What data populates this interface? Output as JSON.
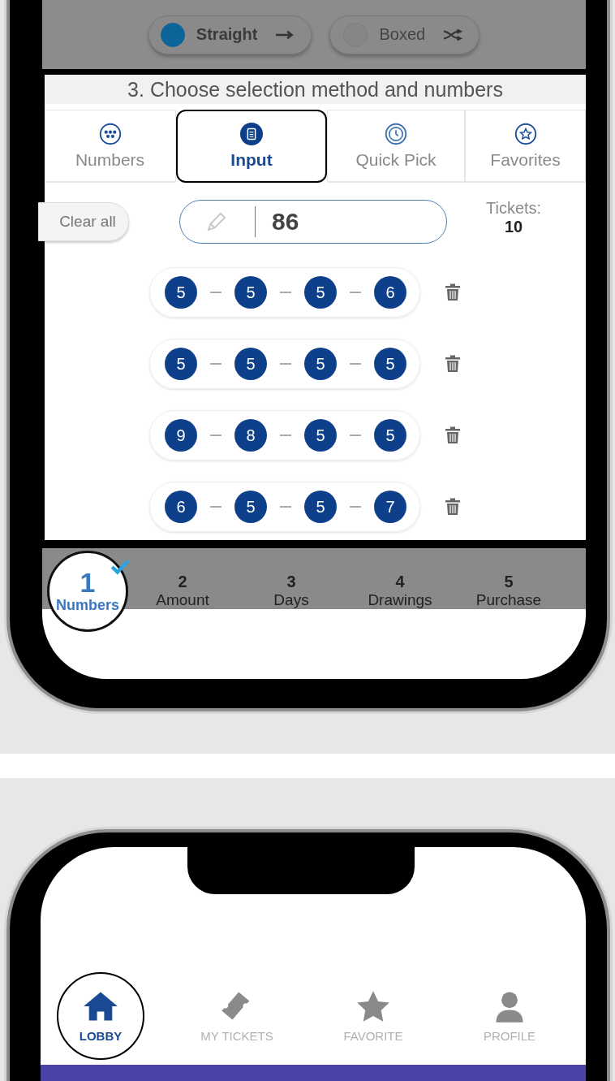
{
  "modes": [
    {
      "label": "Straight",
      "kind": "arrow",
      "selected": true
    },
    {
      "label": "Boxed",
      "kind": "shuffle",
      "selected": false
    }
  ],
  "section_title": "3. Choose selection method and numbers",
  "tabs": [
    {
      "label": "Numbers",
      "kind": "dots",
      "selected": false,
      "highlighted": false
    },
    {
      "label": "Input",
      "kind": "clipboard",
      "selected": true,
      "highlighted": true
    },
    {
      "label": "Quick Pick",
      "kind": "clock",
      "selected": false,
      "highlighted": false
    },
    {
      "label": "Favorites",
      "kind": "star",
      "selected": false,
      "highlighted": false
    }
  ],
  "clear_button": "Clear all",
  "number_input": {
    "value": "86"
  },
  "tickets": {
    "label": "Tickets:",
    "count": "10"
  },
  "entries": [
    {
      "digits": [
        "5",
        "5",
        "5",
        "6"
      ]
    },
    {
      "digits": [
        "5",
        "5",
        "5",
        "5"
      ]
    },
    {
      "digits": [
        "9",
        "8",
        "5",
        "5"
      ]
    },
    {
      "digits": [
        "6",
        "5",
        "5",
        "7"
      ]
    }
  ],
  "steps": [
    {
      "number": "1",
      "label": "Numbers",
      "selected": true,
      "done": true
    },
    {
      "number": "2",
      "label": "Amount",
      "selected": false,
      "done": false
    },
    {
      "number": "3",
      "label": "Days",
      "selected": false,
      "done": false
    },
    {
      "number": "4",
      "label": "Drawings",
      "selected": false,
      "done": false
    },
    {
      "number": "5",
      "label": "Purchase",
      "selected": false,
      "done": false
    }
  ],
  "bottom_nav": [
    {
      "label": "LOBBY",
      "kind": "home",
      "selected": true
    },
    {
      "label": "MY TICKETS",
      "kind": "ticket",
      "selected": false
    },
    {
      "label": "FAVORITE",
      "kind": "star",
      "selected": false
    },
    {
      "label": "PROFILE",
      "kind": "person",
      "selected": false
    }
  ]
}
